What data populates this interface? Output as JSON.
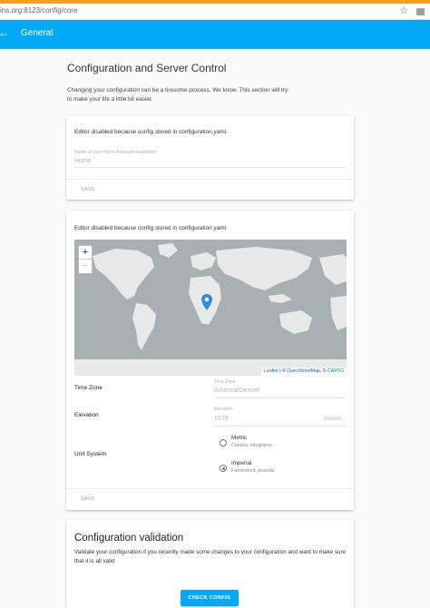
{
  "browser": {
    "url": "ins.org:8123/config/core",
    "star_icon": "star-outline-icon",
    "cast_icon": "cast-icon"
  },
  "appbar": {
    "back_icon": "arrow-left-icon",
    "title": "General"
  },
  "page": {
    "heading": "Configuration and Server Control",
    "intro": "Changing your configuration can be a tiresome process. We know. This section will try to make your life a little bit easier."
  },
  "name_card": {
    "notice": "Editor disabled because config stored in configuration.yaml.",
    "name_label": "Name of your Home Assistant installation",
    "name_value": "Home",
    "save_label": "SAVE"
  },
  "location_card": {
    "notice": "Editor disabled because config stored in configuration.yaml.",
    "map": {
      "zoom_in": "+",
      "zoom_out": "−",
      "attribution_leaflet": "Leaflet",
      "attribution_sep1": " | © ",
      "attribution_osm": "OpenStreetMap",
      "attribution_sep2": ", © ",
      "attribution_carto": "CARTO",
      "marker_icon": "map-marker-icon"
    },
    "time_zone": {
      "row_label": "Time Zone",
      "field_label": "Time Zone",
      "value": "America/Denver"
    },
    "elevation": {
      "row_label": "Elevation",
      "field_label": "Elevation",
      "value": "1579",
      "suffix": "meters"
    },
    "unit_system": {
      "row_label": "Unit System",
      "options": [
        {
          "title": "Metric",
          "subtitle": "Celsius, kilograms",
          "selected": false
        },
        {
          "title": "Imperial",
          "subtitle": "Fahrenheit, pounds",
          "selected": true
        }
      ]
    },
    "save_label": "SAVE"
  },
  "validation_card": {
    "title": "Configuration validation",
    "description": "Validate your configuration if you recently made some changes to your configuration and want to make sure that it is all valid",
    "button_label": "CHECK CONFIG"
  },
  "colors": {
    "primary": "#03a9f4",
    "top_strip": "#f4a023",
    "map_water": "#a9b0b2",
    "map_land": "#e9e9e9",
    "marker": "#2f8fd6"
  }
}
